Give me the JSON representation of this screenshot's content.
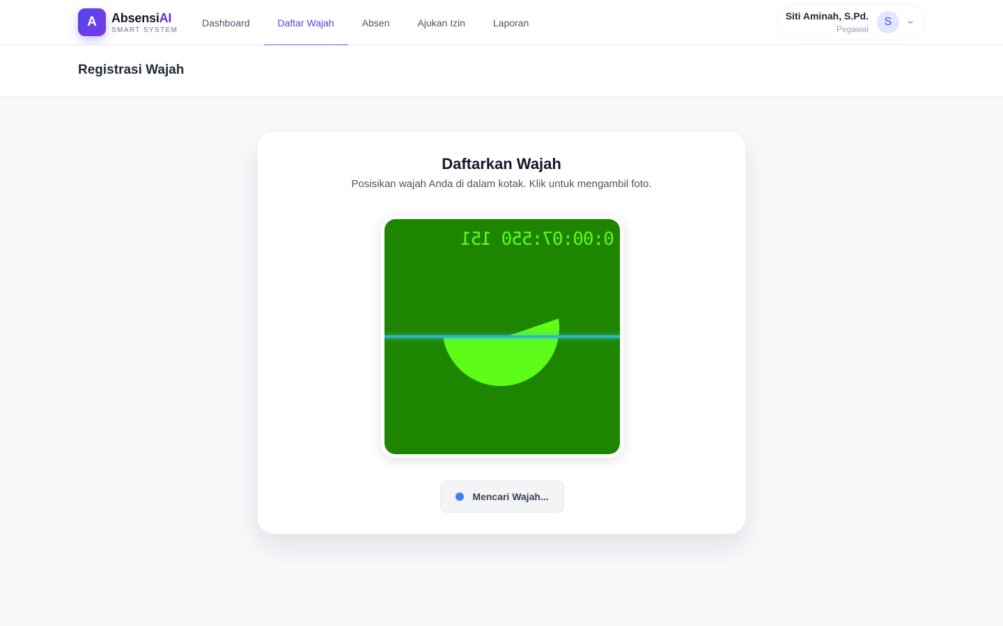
{
  "brand": {
    "logo_letter": "A",
    "name_main": "Absensi",
    "name_accent": "AI",
    "tagline": "SMART SYSTEM",
    "accent_color": "#6d28d9"
  },
  "nav": {
    "items": [
      {
        "label": "Dashboard"
      },
      {
        "label": "Daftar Wajah"
      },
      {
        "label": "Absen"
      },
      {
        "label": "Ajukan Izin"
      },
      {
        "label": "Laporan"
      }
    ],
    "active": "Daftar Wajah",
    "active_color": "#4f46e5"
  },
  "user": {
    "name": "Siti Aminah, S.Pd.",
    "role": "Pegawai",
    "avatar_letter": "S",
    "menu_icon": "chevron-down-icon"
  },
  "page": {
    "title": "Registrasi Wajah"
  },
  "card": {
    "title": "Daftarkan Wajah",
    "subtitle": "Posisikan wajah Anda di dalam kotak. Klik untuk mengambil foto."
  },
  "camera": {
    "timestamp": "0:00:07:550 151",
    "background_color": "#1e8500",
    "shape_color": "#5efc19",
    "scan_line_color": "#2bb7c7"
  },
  "status": {
    "label": "Mencari Wajah...",
    "dot_color": "#3b82f6"
  }
}
